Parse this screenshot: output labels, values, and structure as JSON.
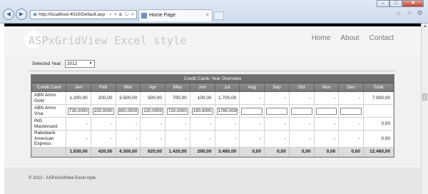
{
  "browser": {
    "address": "http://localhost:4010/Default.asp",
    "address_icons": "⌕ ▾ ⊠ ↻ ×",
    "tab_title": "Home Page",
    "tab_close": "×",
    "win_min": "–",
    "win_max": "□",
    "win_close": "✕",
    "back": "◀",
    "forward": "▶",
    "toolbar_icons": [
      "⌂",
      "☆",
      "⚙"
    ]
  },
  "site": {
    "title": "ASPxGridView Excel style",
    "nav": [
      "Home",
      "About",
      "Contact"
    ],
    "footer": "© 2012 - ASPxGridView Excel style"
  },
  "filter": {
    "label": "Selected Year:",
    "year": "2012"
  },
  "grid": {
    "title": "Credit Cards Year Overview",
    "columns": [
      "Credit Card",
      "Jan",
      "Feb",
      "Mar",
      "Apr",
      "May",
      "Jun",
      "Jul",
      "Aug",
      "Sep",
      "Oct",
      "Nov",
      "Dec",
      "Total"
    ],
    "rows": [
      {
        "name": "ABN Amro Gold",
        "editing": false,
        "cells": [
          "1.200,00",
          "200,00",
          "3.500,00",
          "500,00",
          "700,00",
          "100,00",
          "1.700,00",
          "-",
          "-",
          "-",
          "-",
          "-"
        ],
        "total": "7.900,00"
      },
      {
        "name": "ABN Amro Visa",
        "editing": true,
        "cells": [
          "730,0000",
          "220,0000",
          "800,0000",
          "120,0000",
          "720,0000",
          "190,0000",
          "1780,0000",
          "",
          "",
          "",
          "",
          ""
        ],
        "total": ""
      },
      {
        "name": "ING Mastercard",
        "editing": false,
        "cells": [
          "-",
          "-",
          "-",
          "-",
          "-",
          "-",
          "-",
          "-",
          "-",
          "-",
          "-",
          "-"
        ],
        "total": "0,00"
      },
      {
        "name": "Rabobank American Express",
        "editing": false,
        "cells": [
          "-",
          "-",
          "-",
          "-",
          "-",
          "-",
          "-",
          "-",
          "-",
          "-",
          "-",
          "-"
        ],
        "total": "0,00"
      }
    ],
    "footer": [
      "",
      "1.930,00",
      "420,00",
      "4.300,00",
      "620,00",
      "1.420,00",
      "290,00",
      "3.480,00",
      "0,00",
      "0,00",
      "0,00",
      "0,00",
      "0,00",
      "12.460,00"
    ]
  }
}
